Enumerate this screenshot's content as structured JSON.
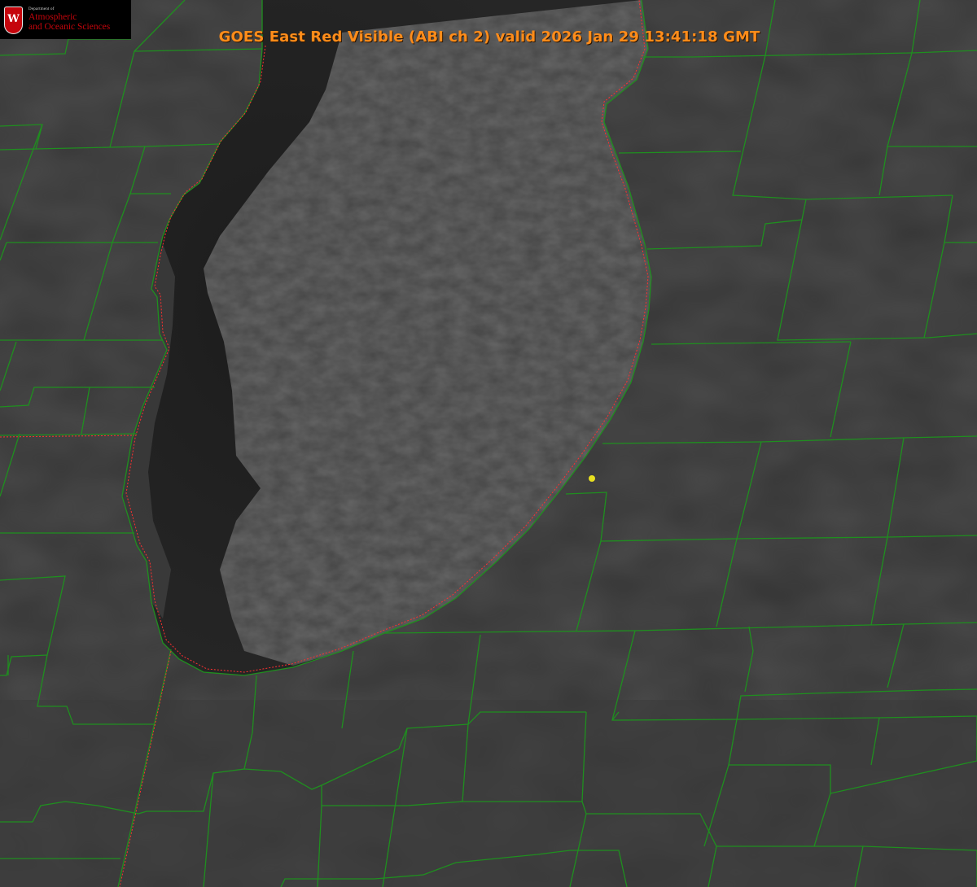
{
  "header": {
    "title": "GOES East Red Visible (ABI ch 2) valid 2026 Jan 29 13:41:18 GMT"
  },
  "logo": {
    "crest_letter": "W",
    "department": "Department of",
    "line1": "Atmospheric",
    "line2": "and Oceanic Sciences",
    "brand_color": "#c5050c"
  },
  "colors": {
    "boundary": "#1f8f1f",
    "state_line": "#ff3030",
    "title": "#ff8c1a",
    "marker": "#e8e020"
  },
  "map": {
    "features": [
      "lake",
      "county-boundaries",
      "shoreline",
      "station-marker"
    ]
  }
}
